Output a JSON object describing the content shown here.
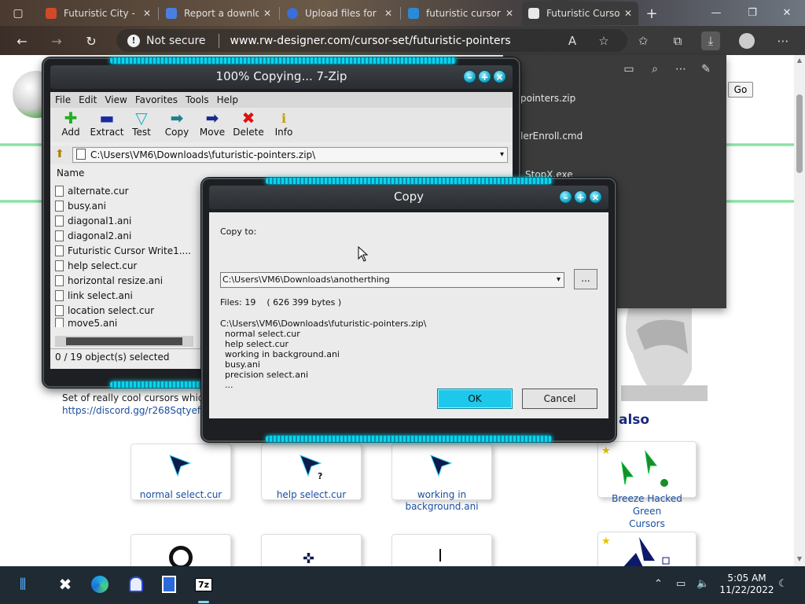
{
  "browser": {
    "tabs": [
      {
        "title": "Futuristic City -",
        "favicon_color": "#d04a2a"
      },
      {
        "title": "Report a downlo",
        "favicon_color": "#4a7ee0"
      },
      {
        "title": "Upload files for",
        "favicon_color": "#3a6fd8"
      },
      {
        "title": "futuristic cursor",
        "favicon_color": "#2a8ad8"
      },
      {
        "title": "Futuristic Curso",
        "favicon_color": "#e8e8e8"
      }
    ],
    "address": {
      "security": "Not secure",
      "url": "www.rw-designer.com/cursor-set/futuristic-pointers"
    }
  },
  "page": {
    "go_button": "Go",
    "description": "Set of really cool cursors which i",
    "discord_link": "https://discord.gg/r268Sqtyef",
    "also_heading": "also",
    "cursor_cards": [
      {
        "label": "normal select.cur"
      },
      {
        "label": "help select.cur"
      },
      {
        "label_line1": "working in",
        "label_line2": "background.ani"
      }
    ],
    "related": {
      "line1": "Breeze Hacked Green",
      "line2": "Cursors"
    }
  },
  "file_panel": {
    "items": [
      "pointers.zip",
      "lerEnroll.cmd",
      "StopX.exe"
    ]
  },
  "sevenzip": {
    "title": "100% Copying... 7-Zip",
    "menu": [
      "File",
      "Edit",
      "View",
      "Favorites",
      "Tools",
      "Help"
    ],
    "toolbar": [
      "Add",
      "Extract",
      "Test",
      "Copy",
      "Move",
      "Delete",
      "Info"
    ],
    "path": "C:\\Users\\VM6\\Downloads\\futuristic-pointers.zip\\",
    "list_header": "Name",
    "files": [
      "alternate.cur",
      "busy.ani",
      "diagonal1.ani",
      "diagonal2.ani",
      "Futuristic Cursor Write1....",
      "help select.cur",
      "horizontal resize.ani",
      "link select.ani",
      "location select.cur",
      "move5.ani"
    ],
    "status": "0 / 19 object(s) selected"
  },
  "copy_dialog": {
    "title": "Copy",
    "copy_to_label": "Copy to:",
    "destination": "C:\\Users\\VM6\\Downloads\\anotherthing",
    "browse": "...",
    "files_info": "Files: 19    ( 626 399 bytes )",
    "source": "C:\\Users\\VM6\\Downloads\\futuristic-pointers.zip\\",
    "items": [
      "normal select.cur",
      "help select.cur",
      "working in background.ani",
      "busy.ani",
      "precision select.ani",
      "..."
    ],
    "ok": "OK",
    "cancel": "Cancel"
  },
  "taskbar": {
    "time": "5:05 AM",
    "date": "11/22/2022"
  }
}
